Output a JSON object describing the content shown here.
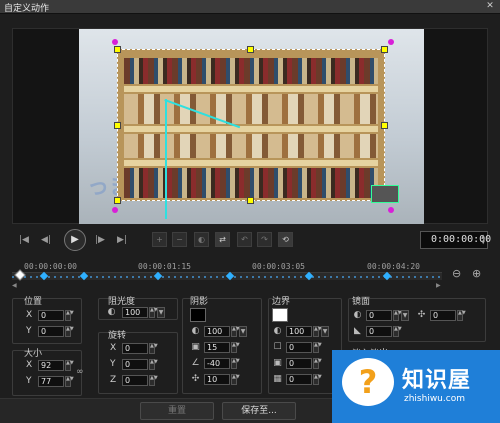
{
  "window": {
    "title": "自定义动作",
    "close_glyph": "✕"
  },
  "preview": {
    "watermark": "っま",
    "icons": {
      "vertical_line": "cyan-guide",
      "handles": "yellow-square",
      "corners": "magenta-dot"
    }
  },
  "transport": {
    "buttons": [
      {
        "name": "go-start",
        "glyph": "|◀"
      },
      {
        "name": "prev-frame",
        "glyph": "◀|"
      },
      {
        "name": "play",
        "glyph": "▶"
      },
      {
        "name": "next-frame",
        "glyph": "|▶"
      },
      {
        "name": "go-end",
        "glyph": "▶|"
      }
    ],
    "keyframe_tools": [
      {
        "name": "add-keyframe",
        "glyph": "+"
      },
      {
        "name": "remove-keyframe",
        "glyph": "−"
      },
      {
        "name": "reverse-keyframe",
        "glyph": "◐"
      },
      {
        "name": "swap-keyframe",
        "glyph": "⇄"
      },
      {
        "name": "move-left-keyframe",
        "glyph": "↶"
      },
      {
        "name": "move-right-keyframe",
        "glyph": "↷"
      },
      {
        "name": "reset-keyframe",
        "glyph": "⟲"
      }
    ],
    "timecode": "0:00:00:00"
  },
  "timeline": {
    "labels": [
      "00:00:00:00",
      "00:00:01:15",
      "00:00:03:05",
      "00:00:04:20"
    ],
    "zoom_out_glyph": "⊖",
    "zoom_in_glyph": "⊕",
    "scroll_left": "◀",
    "scroll_right": "▶"
  },
  "props": {
    "position": {
      "label": "位置",
      "x_label": "X",
      "x": "0",
      "y_label": "Y",
      "y": "0"
    },
    "size": {
      "label": "大小",
      "x_label": "X",
      "x": "92",
      "y_label": "Y",
      "y": "77"
    },
    "opacity": {
      "label": "阻光度",
      "value": "100"
    },
    "rotation": {
      "label": "旋转",
      "x_label": "X",
      "x": "0",
      "y_label": "Y",
      "y": "0",
      "z_label": "Z",
      "z": "0"
    },
    "shadow": {
      "label": "阴影",
      "color": "#000000",
      "values": [
        "100",
        "15",
        "-40",
        "10"
      ]
    },
    "border": {
      "label": "边界",
      "color": "#ffffff",
      "values": [
        "100",
        "0",
        "0",
        "0"
      ]
    },
    "mirror": {
      "label": "镜面",
      "values": [
        "0",
        "0",
        "0"
      ]
    },
    "fade": {
      "label": "淡入淡出"
    }
  },
  "bottom": {
    "reset": "重置",
    "save_to": "保存至..."
  },
  "logo": {
    "brand": "知识屋",
    "url": "zhishiwu.com",
    "glyph": "?"
  }
}
